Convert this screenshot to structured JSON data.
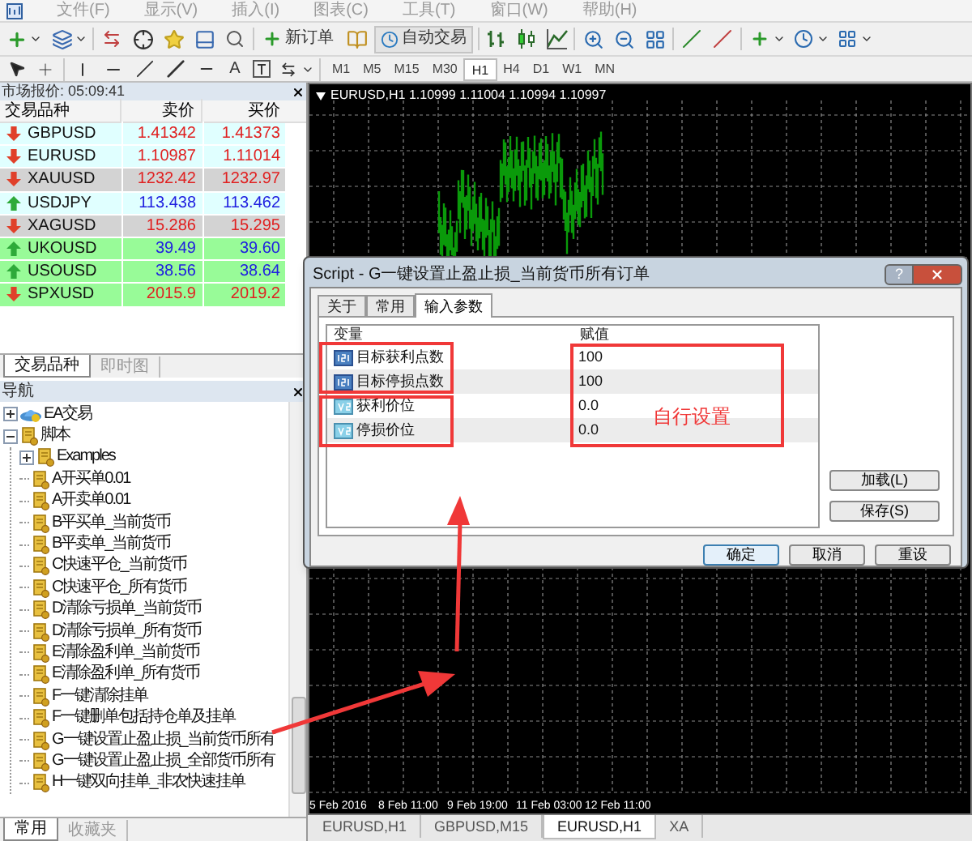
{
  "menu": [
    "文件(F)",
    "显示(V)",
    "插入(I)",
    "图表(C)",
    "工具(T)",
    "窗口(W)",
    "帮助(H)"
  ],
  "toolbar": {
    "new_order": "新订单",
    "auto_trading": "自动交易",
    "text_tool": "A",
    "timeframes": [
      {
        "label": "M1",
        "selected": false
      },
      {
        "label": "M5",
        "selected": false
      },
      {
        "label": "M15",
        "selected": false
      },
      {
        "label": "M30",
        "selected": false
      },
      {
        "label": "H1",
        "selected": true
      },
      {
        "label": "H4",
        "selected": false
      },
      {
        "label": "D1",
        "selected": false
      },
      {
        "label": "W1",
        "selected": false
      },
      {
        "label": "MN",
        "selected": false
      }
    ]
  },
  "market_watch": {
    "title": "市场报价: 05:09:41",
    "columns": [
      "交易品种",
      "卖价",
      "买价"
    ],
    "rows": [
      {
        "symbol": "GBPUSD",
        "bid": "1.41342",
        "ask": "1.41373",
        "rising": false,
        "color": "#e0ffff"
      },
      {
        "symbol": "EURUSD",
        "bid": "1.10987",
        "ask": "1.11014",
        "rising": false,
        "color": "#e0ffff"
      },
      {
        "symbol": "XAUUSD",
        "bid": "1232.42",
        "ask": "1232.97",
        "rising": false,
        "color": "#d3d3d3"
      },
      {
        "symbol": "USDJPY",
        "bid": "113.438",
        "ask": "113.462",
        "rising": true,
        "color": "#e0ffff"
      },
      {
        "symbol": "XAGUSD",
        "bid": "15.286",
        "ask": "15.295",
        "rising": false,
        "color": "#d3d3d3"
      },
      {
        "symbol": "UKOUSD",
        "bid": "39.49",
        "ask": "39.60",
        "rising": true,
        "color": "#98fb98"
      },
      {
        "symbol": "USOUSD",
        "bid": "38.56",
        "ask": "38.64",
        "rising": true,
        "color": "#98fb98"
      },
      {
        "symbol": "SPXUSD",
        "bid": "2015.9",
        "ask": "2019.2",
        "rising": false,
        "color": "#98fb98"
      }
    ],
    "tabs": [
      {
        "label": "交易品种",
        "selected": true
      },
      {
        "label": "即时图",
        "selected": false
      }
    ]
  },
  "navigator": {
    "title": "导航",
    "tree": [
      {
        "label": "EA交易",
        "kind": "experts",
        "expanded": false
      },
      {
        "label": "脚本",
        "kind": "script",
        "expanded": true,
        "children": [
          {
            "label": "Examples",
            "kind": "script",
            "expanded": false
          },
          {
            "label": "A开买单0.01",
            "kind": "script"
          },
          {
            "label": "A开卖单0.01",
            "kind": "script"
          },
          {
            "label": "B平买单_当前货币",
            "kind": "script"
          },
          {
            "label": "B平卖单_当前货币",
            "kind": "script"
          },
          {
            "label": "C快速平仓_当前货币",
            "kind": "script"
          },
          {
            "label": "C快速平仓_所有货币",
            "kind": "script"
          },
          {
            "label": "D清除亏损单_当前货币",
            "kind": "script"
          },
          {
            "label": "D清除亏损单_所有货币",
            "kind": "script"
          },
          {
            "label": "E清除盈利单_当前货币",
            "kind": "script"
          },
          {
            "label": "E清除盈利单_所有货币",
            "kind": "script"
          },
          {
            "label": "F一键清除挂单",
            "kind": "script"
          },
          {
            "label": "F一键删单包括持仓单及挂单",
            "kind": "script"
          },
          {
            "label": "G一键设置止盈止损_当前货币所有",
            "kind": "script"
          },
          {
            "label": "G一键设置止盈止损_全部货币所有",
            "kind": "script"
          },
          {
            "label": "H一键双向挂单_非农快速挂单",
            "kind": "script"
          }
        ]
      }
    ],
    "tabs": [
      {
        "label": "常用",
        "selected": true
      },
      {
        "label": "收藏夹",
        "selected": false
      }
    ]
  },
  "chart": {
    "title": "EURUSD,H1  1.10999 1.11004 1.10994 1.10997",
    "collapsed": false,
    "time_labels": [
      "5 Feb 2016",
      "8 Feb 11:00",
      "9 Feb 19:00",
      "11 Feb 03:00",
      "12 Feb 11:00"
    ],
    "tabs": [
      {
        "label": "EURUSD,H1",
        "selected": false
      },
      {
        "label": "GBPUSD,M15",
        "selected": false
      },
      {
        "label": "EURUSD,H1",
        "selected": true
      },
      {
        "label": "XA",
        "selected": false
      }
    ]
  },
  "dialog": {
    "title": "Script - G一键设置止盈止损_当前货币所有订单",
    "help": "?",
    "tabs": [
      {
        "label": "关于",
        "selected": false
      },
      {
        "label": "常用",
        "selected": false
      },
      {
        "label": "输入参数",
        "selected": true
      }
    ],
    "columns": [
      "变量",
      "赋值"
    ],
    "params": [
      {
        "name": "目标获利点数",
        "value": "100",
        "kind": "int"
      },
      {
        "name": "目标停损点数",
        "value": "100",
        "kind": "int"
      },
      {
        "name": "获利价位",
        "value": "0.0",
        "kind": "double"
      },
      {
        "name": "停损价位",
        "value": "0.0",
        "kind": "double"
      }
    ],
    "side_buttons": [
      "加载(L)",
      "保存(S)"
    ],
    "buttons": [
      {
        "label": "确定",
        "default": true
      },
      {
        "label": "取消",
        "default": false
      },
      {
        "label": "重设",
        "default": false
      }
    ]
  },
  "annotation": {
    "label": "自行设置"
  }
}
